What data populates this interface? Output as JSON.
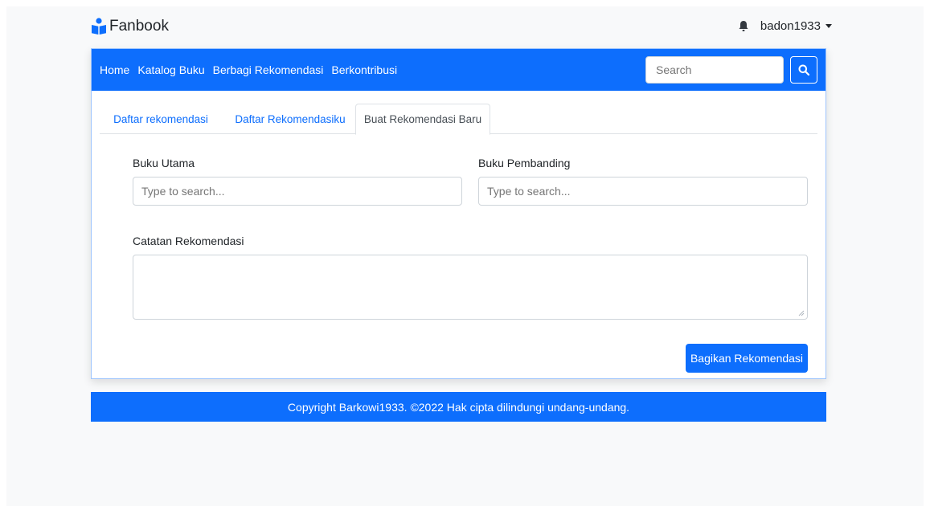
{
  "brand": {
    "name": "Fanbook",
    "icon": "book-reader-icon",
    "color": "#0d6efd"
  },
  "user": {
    "notification_icon": "bell-icon",
    "username": "badon1933"
  },
  "navbar": {
    "links": [
      "Home",
      "Katalog Buku",
      "Berbagi Rekomendasi",
      "Berkontribusi"
    ],
    "search_placeholder": "Search",
    "search_icon": "search-icon"
  },
  "tabs": [
    {
      "label": "Daftar rekomendasi",
      "active": false
    },
    {
      "label": "Daftar Rekomendasiku",
      "active": false
    },
    {
      "label": "Buat Rekomendasi Baru",
      "active": true
    }
  ],
  "form": {
    "main_book_label": "Buku Utama",
    "main_book_placeholder": "Type to search...",
    "compare_book_label": "Buku Pembanding",
    "compare_book_placeholder": "Type to search...",
    "notes_label": "Catatan Rekomendasi",
    "notes_value": "",
    "submit_label": "Bagikan Rekomendasi"
  },
  "footer": {
    "text": "Copyright Barkowi1933. ©2022 Hak cipta dilindungi undang-undang."
  },
  "colors": {
    "primary": "#0d6efd",
    "background": "#f8f9fa"
  }
}
